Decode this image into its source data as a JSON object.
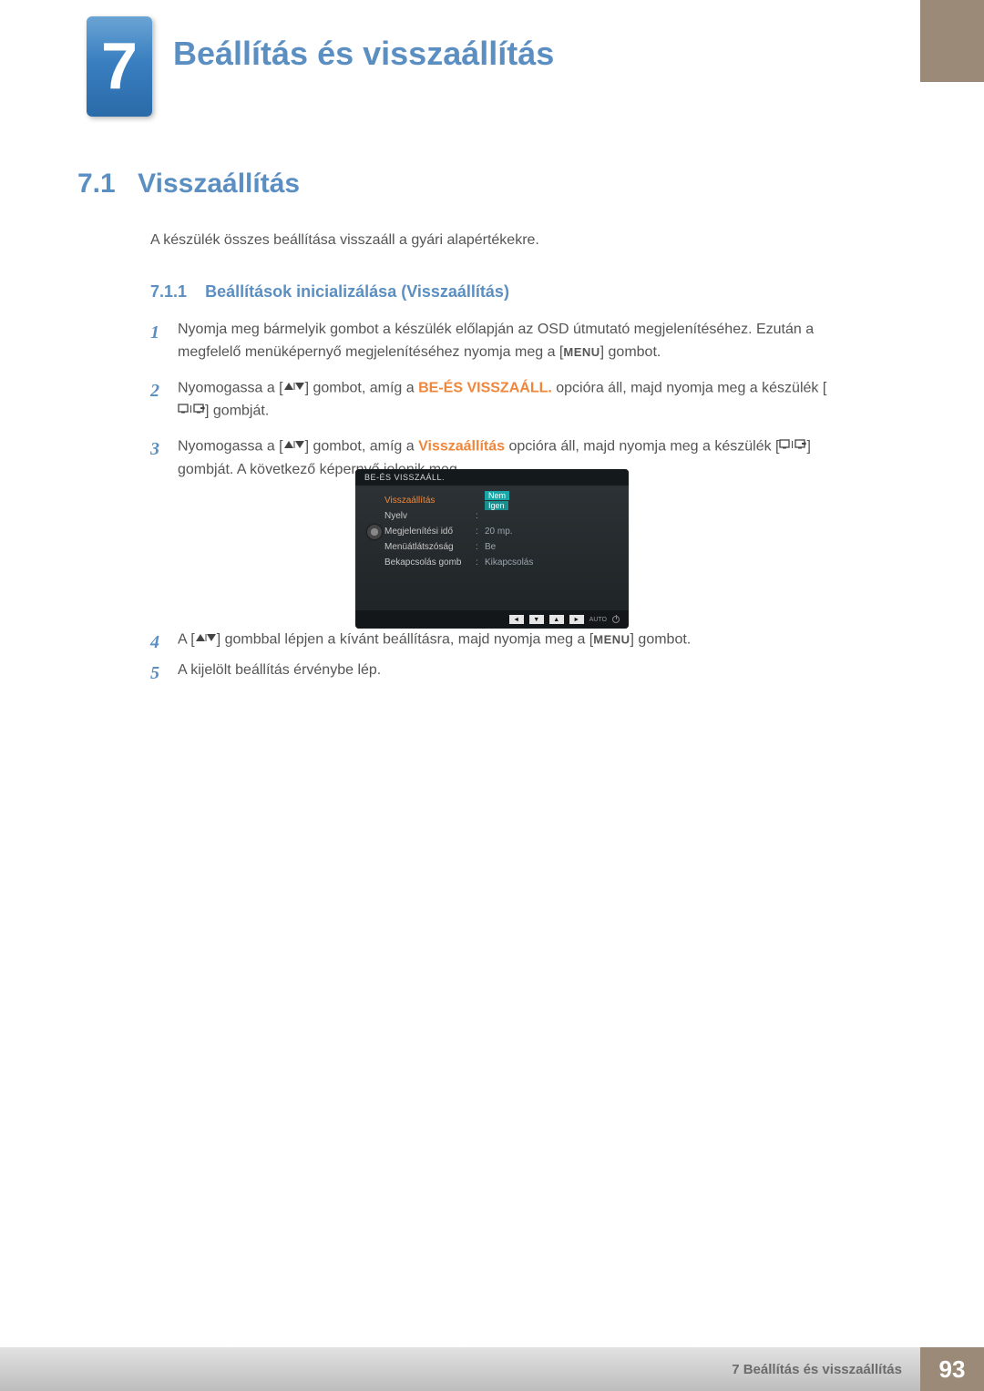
{
  "chapter": {
    "number": "7",
    "title": "Beállítás és visszaállítás"
  },
  "section": {
    "number": "7.1",
    "title": "Visszaállítás"
  },
  "intro": "A készülék összes beállítása visszaáll a gyári alapértékekre.",
  "subsection": {
    "number": "7.1.1",
    "title": "Beállítások inicializálása (Visszaállítás)"
  },
  "steps": {
    "s1": {
      "num": "1",
      "a": "Nyomja meg bármelyik gombot a készülék előlapján az OSD útmutató megjelenítéséhez. Ezután a megfelelő menüképernyő megjelenítéséhez nyomja meg a [",
      "key": "MENU",
      "b": "] gombot."
    },
    "s2": {
      "num": "2",
      "a": "Nyomogassa a [",
      "b": "] gombot, amíg a ",
      "opt": "BE-ÉS VISSZAÁLL.",
      "c": " opcióra áll, majd nyomja meg a készülék [",
      "d": "] gombját."
    },
    "s3": {
      "num": "3",
      "a": "Nyomogassa a [",
      "b": "] gombot, amíg a ",
      "opt": "Visszaállítás",
      "c": " opcióra áll, majd nyomja meg a készülék [",
      "d": "] gombját. A következő képernyő jelenik meg."
    },
    "s4": {
      "num": "4",
      "a": "A [",
      "b": "] gombbal lépjen a kívánt beállításra, majd nyomja meg a [",
      "key": "MENU",
      "c": "] gombot."
    },
    "s5": {
      "num": "5",
      "text": "A kijelölt beállítás érvénybe lép."
    }
  },
  "osd": {
    "title": "BE-ÉS VISSZAÁLL.",
    "rows": [
      {
        "label": "Visszaállítás",
        "val_hi": "Nem",
        "val_dim": "Igen",
        "selected": true
      },
      {
        "label": "Nyelv",
        "val": ""
      },
      {
        "label": "Megjelenítési idő",
        "val": "20 mp."
      },
      {
        "label": "Menüátlátszóság",
        "val": "Be"
      },
      {
        "label": "Bekapcsolás gomb",
        "val": "Kikapcsolás"
      }
    ],
    "auto": "AUTO"
  },
  "footer": {
    "chapter_ref": "7 Beállítás és visszaállítás",
    "page": "93"
  }
}
